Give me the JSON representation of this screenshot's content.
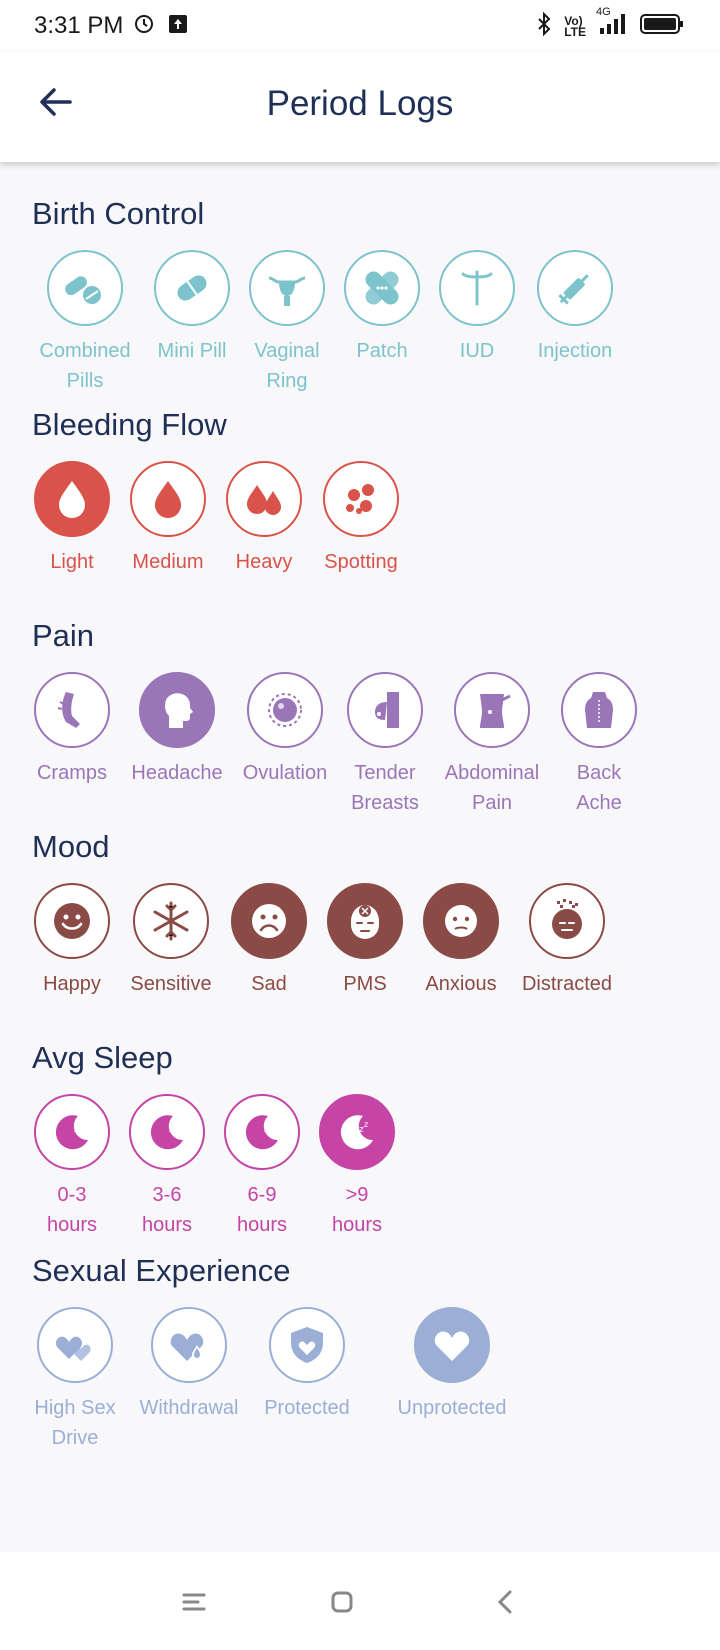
{
  "status_bar": {
    "time": "3:31 PM",
    "network_top": "Vo)",
    "network_bottom": "LTE",
    "signal_label": "4G",
    "icons": [
      "clock-icon",
      "upload-icon",
      "bluetooth-icon",
      "signal-icon",
      "battery-icon"
    ]
  },
  "header": {
    "title": "Period Logs",
    "back_icon": "arrow-left-icon"
  },
  "colors": {
    "birth_control": "#7cc3cb",
    "bleeding_flow": "#d9534a",
    "pain": "#9a76b8",
    "mood": "#8a4a46",
    "avg_sleep": "#c544a6",
    "sexual_experience": "#9aaed6",
    "title": "#1f2f55"
  },
  "sections": {
    "birth_control": {
      "title": "Birth Control",
      "items": [
        {
          "label": "Combined\nPills",
          "icon": "pills-icon"
        },
        {
          "label": "Mini Pill",
          "icon": "capsule-icon"
        },
        {
          "label": "Vaginal\nRing",
          "icon": "uterus-icon"
        },
        {
          "label": "Patch",
          "icon": "bandage-icon"
        },
        {
          "label": "IUD",
          "icon": "iud-icon"
        },
        {
          "label": "Injection",
          "icon": "syringe-icon"
        }
      ]
    },
    "bleeding_flow": {
      "title": "Bleeding Flow",
      "items": [
        {
          "label": "Light",
          "icon": "drop-icon",
          "selected": true
        },
        {
          "label": "Medium",
          "icon": "drop-icon",
          "selected": false
        },
        {
          "label": "Heavy",
          "icon": "drops-icon",
          "selected": false
        },
        {
          "label": "Spotting",
          "icon": "spots-icon",
          "selected": false
        }
      ]
    },
    "pain": {
      "title": "Pain",
      "items": [
        {
          "label": "Cramps",
          "icon": "cramps-icon",
          "selected": false
        },
        {
          "label": "Headache",
          "icon": "headache-icon",
          "selected": true
        },
        {
          "label": "Ovulation",
          "icon": "ovum-icon",
          "selected": false
        },
        {
          "label": "Tender\nBreasts",
          "icon": "breast-icon",
          "selected": false
        },
        {
          "label": "Abdominal\nPain",
          "icon": "abdomen-icon",
          "selected": false
        },
        {
          "label": "Back\nAche",
          "icon": "back-icon",
          "selected": false
        }
      ]
    },
    "mood": {
      "title": "Mood",
      "items": [
        {
          "label": "Happy",
          "icon": "happy-face-icon",
          "selected": false
        },
        {
          "label": "Sensitive",
          "icon": "snowflake-icon",
          "selected": false
        },
        {
          "label": "Sad",
          "icon": "sad-face-icon",
          "selected": true
        },
        {
          "label": "PMS",
          "icon": "pms-face-icon",
          "selected": true
        },
        {
          "label": "Anxious",
          "icon": "anxious-face-icon",
          "selected": true
        },
        {
          "label": "Distracted",
          "icon": "distracted-face-icon",
          "selected": false
        }
      ]
    },
    "avg_sleep": {
      "title": "Avg Sleep",
      "items": [
        {
          "label": "0-3\nhours",
          "icon": "moon-sleep-icon",
          "selected": false
        },
        {
          "label": "3-6\nhours",
          "icon": "moon-sleep-icon",
          "selected": false
        },
        {
          "label": "6-9\nhours",
          "icon": "moon-sleep-icon",
          "selected": false
        },
        {
          "label": ">9\nhours",
          "icon": "moon-sleep-icon",
          "selected": true
        }
      ]
    },
    "sexual_experience": {
      "title": "Sexual Experience",
      "items": [
        {
          "label": "High Sex\nDrive",
          "icon": "hearts-icon",
          "selected": false
        },
        {
          "label": "Withdrawal",
          "icon": "heart-drop-icon",
          "selected": false
        },
        {
          "label": "Protected",
          "icon": "shield-heart-icon",
          "selected": false
        },
        {
          "label": "Unprotected",
          "icon": "heart-icon",
          "selected": true
        }
      ]
    }
  },
  "nav": {
    "buttons": [
      "menu-icon",
      "home-icon",
      "back-icon"
    ]
  }
}
